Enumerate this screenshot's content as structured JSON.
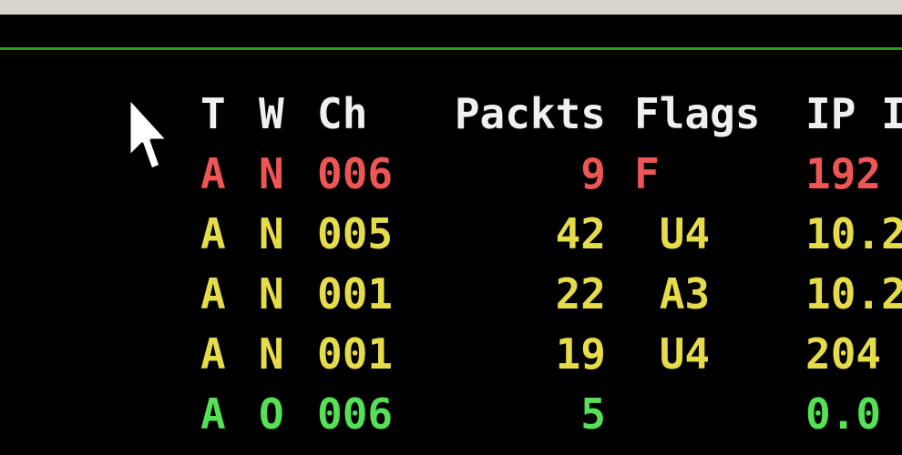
{
  "colors": {
    "background": "#000000",
    "titlebar": "#d8d4cc",
    "separator": "#1fa01f",
    "header": "#f0f0f0",
    "red": "#ee5555",
    "yellow": "#e6dc4a",
    "green": "#55e055"
  },
  "table": {
    "headers": [
      "T",
      "W",
      "Ch",
      "Packts",
      "Flags",
      "IP I"
    ],
    "rows": [
      {
        "t": "A",
        "w": "N",
        "ch": "006",
        "packets": "9",
        "flags": "F",
        "ip": "192",
        "color": "#ee5555"
      },
      {
        "t": "A",
        "w": "N",
        "ch": "005",
        "packets": "42",
        "flags": " U4",
        "ip": "10.2",
        "color": "#e6dc4a"
      },
      {
        "t": "A",
        "w": "N",
        "ch": "001",
        "packets": "22",
        "flags": " A3",
        "ip": "10.2",
        "color": "#e6dc4a"
      },
      {
        "t": "A",
        "w": "N",
        "ch": "001",
        "packets": "19",
        "flags": " U4",
        "ip": "204",
        "color": "#e6dc4a"
      },
      {
        "t": "A",
        "w": "O",
        "ch": "006",
        "packets": "5",
        "flags": "",
        "ip": "0.0",
        "color": "#55e055"
      }
    ]
  },
  "cursor": {
    "icon": "mouse-pointer-icon"
  }
}
